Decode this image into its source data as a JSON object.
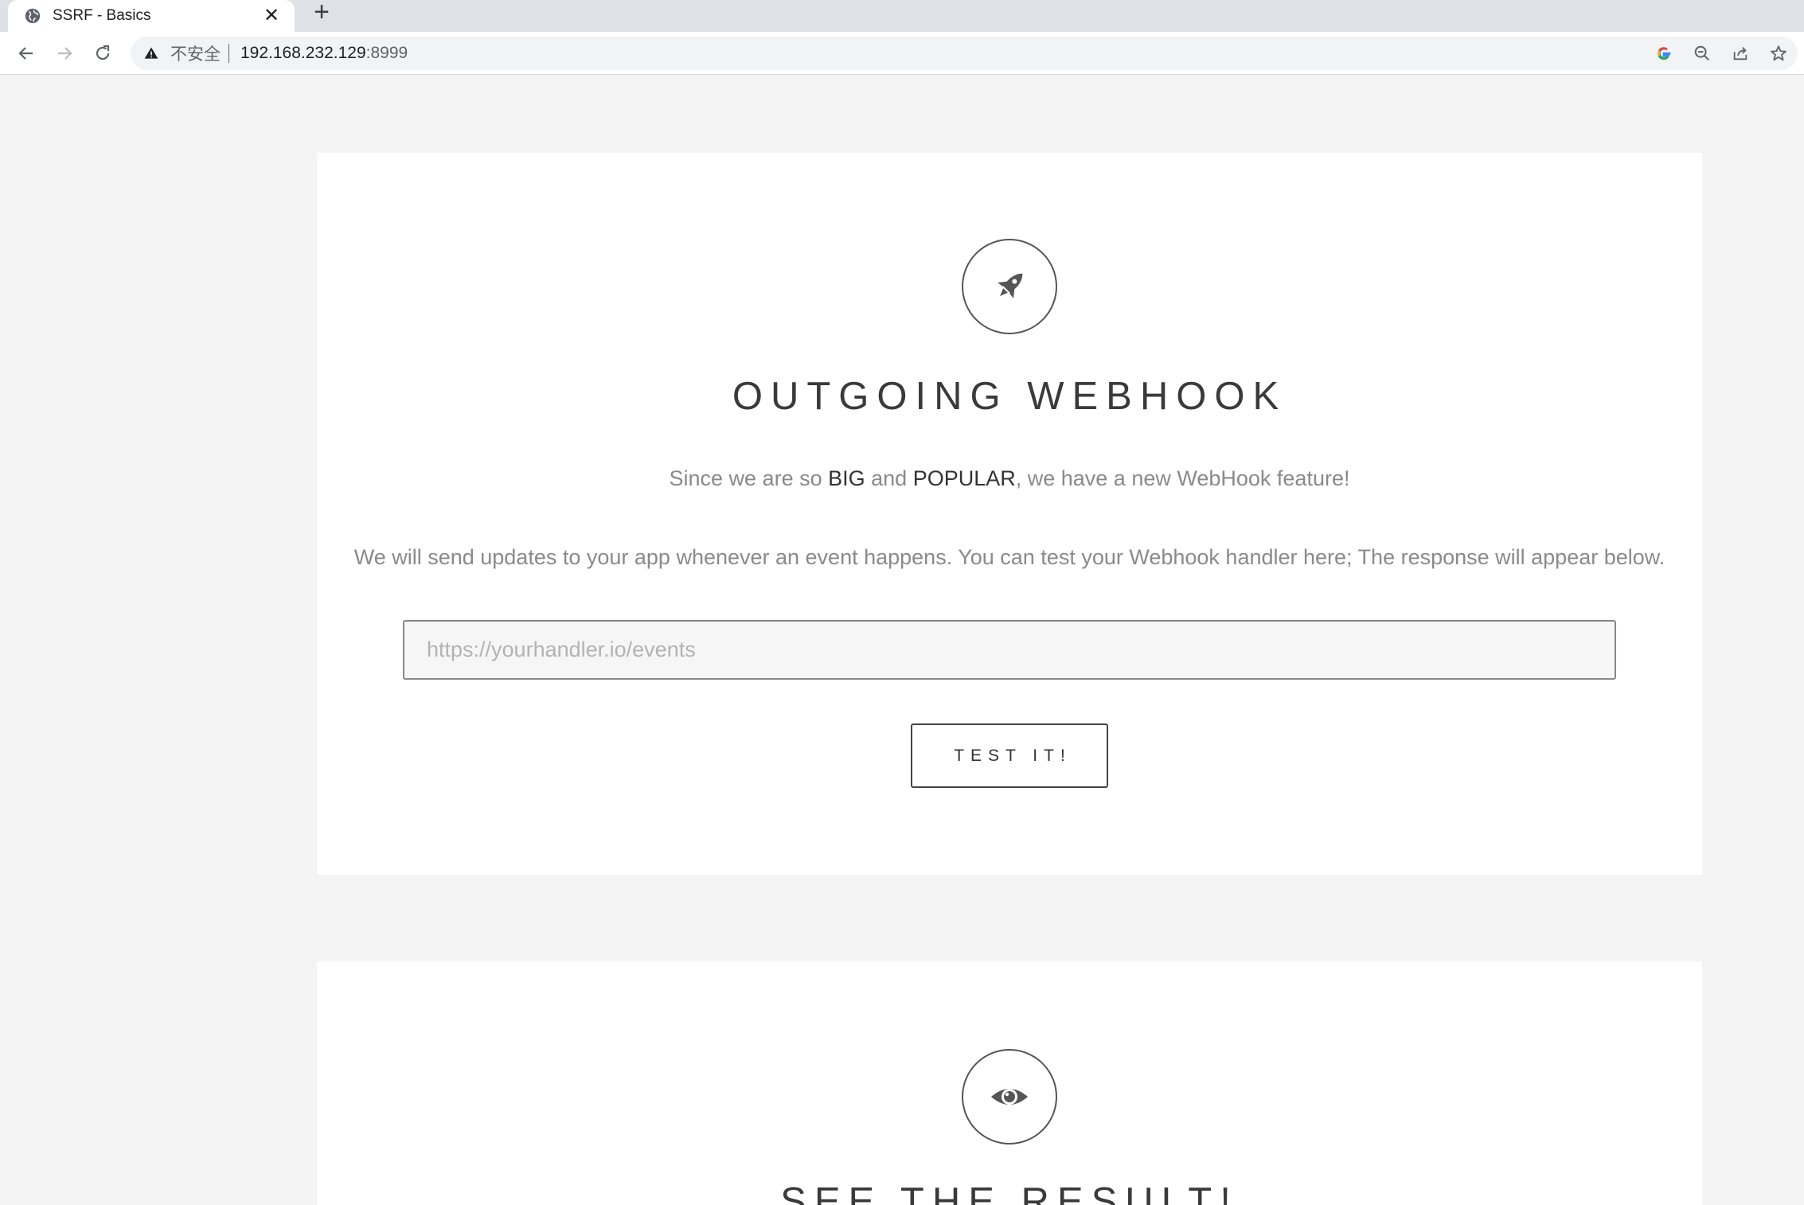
{
  "browser": {
    "tab_title": "SSRF - Basics",
    "tab_close": "✕",
    "new_tab": "+",
    "insecure_label": "不安全",
    "url_host": "192.168.232.129",
    "url_port": ":8999"
  },
  "webhook_card": {
    "icon": "rocket-icon",
    "heading": "OUTGOING WEBHOOK",
    "lead_pre": "Since we are so ",
    "lead_big": "BIG",
    "lead_mid": " and ",
    "lead_popular": "POPULAR",
    "lead_post": ", we have a new WebHook feature!",
    "description": "We will send updates to your app whenever an event happens. You can test your Webhook handler here; The response will appear below.",
    "input_placeholder": "https://yourhandler.io/events",
    "input_value": "",
    "button_label": "TEST IT!"
  },
  "result_card": {
    "icon": "eye-icon",
    "heading": "SEE THE RESULT!"
  },
  "colors": {
    "page_background": "#f4f4f4",
    "card_background": "#ffffff",
    "heading_text": "#3a3a3a",
    "muted_text": "#8a8a8a",
    "tabstrip": "#dee1e6"
  }
}
